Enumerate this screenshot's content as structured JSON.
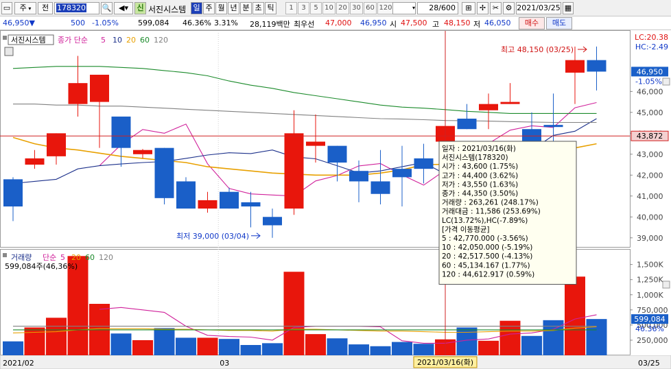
{
  "toolbar": {
    "market_label": "주",
    "prev_label": "전",
    "code": "178320",
    "credit_label": "신",
    "stock_name": "서진시스템",
    "period_tabs": [
      "일",
      "주",
      "월",
      "년",
      "분",
      "초",
      "틱"
    ],
    "active_period": "일",
    "minute_values": [
      "1",
      "3",
      "5",
      "10",
      "20",
      "30",
      "60",
      "120"
    ],
    "count": "28/600",
    "date": "2021/03/25"
  },
  "quote": {
    "price": "46,950",
    "arrow": "▼",
    "change": "500",
    "change_pct": "-1.05%",
    "volume": "599,084",
    "volume_ratio": "46.36%",
    "turnover": "3.31%",
    "amount": "28,119백만",
    "best_bid_label": "최우선",
    "best_ask": "47,000",
    "best_bid": "46,950",
    "open_label": "시",
    "open": "47,500",
    "high_label": "고",
    "high": "48,150",
    "low_label": "저",
    "low": "46,050",
    "buy_label": "매수",
    "sell_label": "매도"
  },
  "price_panel": {
    "title": "서진시스템",
    "ma_label": "종가 단순",
    "ma_periods": [
      "5",
      "10",
      "20",
      "60",
      "120"
    ],
    "lc": "LC:20.38",
    "hc": "HC:-2.49",
    "high_annotation": "최고 48,150 (03/25)",
    "low_annotation": "최저 39,000 (03/04)",
    "last_price_tag": "46,950",
    "last_pct_tag": "-1.05%",
    "crosshair_price_tag": "43,872",
    "y_ticks": [
      "46,000",
      "45,000",
      "44,000",
      "43,000",
      "42,000",
      "41,000",
      "40,000",
      "39,000"
    ]
  },
  "volume_panel": {
    "title": "거래량",
    "ma_label": "단순",
    "ma_periods": [
      "5",
      "20",
      "60",
      "120"
    ],
    "volume_text": "599,084주(46,36%)",
    "last_volume_tag": "599,084",
    "last_pct_tag": "46.36%",
    "y_ticks": [
      "1,500K",
      "1,250K",
      "1,000K",
      "750,000",
      "500,000",
      "250,000"
    ]
  },
  "x_axis": {
    "labels": [
      "2021/02",
      "03"
    ],
    "crosshair_date": "2021/03/16(화)",
    "right_label": "03/25"
  },
  "tooltip": {
    "lines": [
      "일자       : 2021/03/16(화)",
      "서진시스템(178320)",
      " 시가      : 43,600 (1.75%)",
      " 고가      : 44,400 (3.62%)",
      " 저가      : 43,550 (1.63%)",
      " 종가      : 44,350 (3.50%)",
      " 거래량    : 263,261 (248.17%)",
      " 거래대금  : 11,586 (253.69%)",
      " LC(13.72%),HC(-7.89%)",
      "[가격 이동평균]",
      " 5         : 42,770.000 (-3.56%)",
      " 10        : 42,050.000 (-5.19%)",
      " 20        : 42,517.500 (-4.13%)",
      " 60        : 45,134.167 (1.77%)",
      " 120       : 44,612.917 (0.59%)"
    ]
  },
  "colors": {
    "up": "#e8160c",
    "down": "#1a5fc8",
    "ma5": "#d0209a",
    "ma10": "#1a2f8a",
    "ma20": "#e8a000",
    "ma60": "#1a8a2a",
    "ma120": "#808080"
  },
  "chart_data": {
    "type": "candlestick",
    "x": [
      "02/15",
      "02/16",
      "02/17",
      "02/18",
      "02/19",
      "02/22",
      "02/23",
      "02/24",
      "02/25",
      "02/26",
      "03/02",
      "03/03",
      "03/04",
      "03/05",
      "03/08",
      "03/09",
      "03/10",
      "03/11",
      "03/12",
      "03/15",
      "03/16",
      "03/17",
      "03/18",
      "03/19",
      "03/22",
      "03/23",
      "03/24",
      "03/25"
    ],
    "open": [
      41800,
      42500,
      42900,
      45400,
      45500,
      44800,
      43000,
      43300,
      41700,
      40400,
      41200,
      40700,
      40000,
      40400,
      43400,
      43400,
      42200,
      41700,
      42300,
      42800,
      43600,
      44700,
      45100,
      45400,
      44200,
      44400,
      46900,
      47500
    ],
    "high": [
      41900,
      43200,
      44000,
      47700,
      46700,
      44800,
      43250,
      43300,
      41900,
      41200,
      41400,
      41200,
      40400,
      45100,
      44900,
      43400,
      42700,
      43200,
      43400,
      43500,
      44400,
      45400,
      45900,
      46400,
      45000,
      45900,
      48150,
      48150
    ],
    "low": [
      39800,
      42300,
      42500,
      44800,
      43300,
      42400,
      42800,
      40600,
      41000,
      40200,
      40400,
      39500,
      39000,
      40100,
      42600,
      41700,
      40700,
      40600,
      40500,
      41600,
      43550,
      44200,
      44200,
      45400,
      42800,
      43600,
      45400,
      46050
    ],
    "close": [
      40500,
      42800,
      44000,
      46400,
      46800,
      43300,
      43200,
      40900,
      40400,
      40800,
      40400,
      40500,
      39600,
      44000,
      43600,
      42600,
      41700,
      41100,
      41900,
      42300,
      44350,
      44200,
      45400,
      45500,
      43300,
      44300,
      47500,
      46950
    ],
    "volume": [
      230000,
      460000,
      620000,
      1640000,
      850000,
      360000,
      250000,
      450000,
      290000,
      290000,
      270000,
      170000,
      200000,
      1380000,
      350000,
      280000,
      180000,
      150000,
      220000,
      190000,
      263261,
      460000,
      240000,
      570000,
      320000,
      580000,
      1300000,
      599084
    ],
    "series": [
      {
        "name": "5",
        "values": [
          null,
          null,
          null,
          null,
          42450,
          43460,
          44180,
          44000,
          44440,
          42540,
          41360,
          41100,
          41050,
          41000,
          41720,
          41980,
          42440,
          42550,
          42010,
          41520,
          42240,
          42740,
          43510,
          44150,
          44360,
          44280,
          45220,
          45470
        ]
      },
      {
        "name": "10",
        "values": [
          41600,
          41700,
          41800,
          42300,
          42450,
          42530,
          42600,
          42650,
          42800,
          42960,
          43070,
          43030,
          43200,
          42870,
          42780,
          42450,
          42100,
          42200,
          42400,
          42600,
          42050,
          42280,
          42630,
          42900,
          43200,
          43900,
          44100,
          44700
        ]
      },
      {
        "name": "20",
        "values": [
          43800,
          43500,
          43300,
          43200,
          43050,
          42900,
          42800,
          42700,
          42600,
          42400,
          42300,
          42200,
          42100,
          42050,
          42000,
          42000,
          42000,
          42100,
          42250,
          42500,
          42517,
          42600,
          42750,
          42900,
          43000,
          43100,
          43300,
          43500
        ]
      },
      {
        "name": "60",
        "values": [
          47100,
          47150,
          47200,
          47200,
          47200,
          47150,
          47100,
          47000,
          46900,
          46750,
          46500,
          46300,
          46150,
          45950,
          45800,
          45650,
          45500,
          45350,
          45250,
          45200,
          45134,
          45050,
          45000,
          44950,
          44950,
          44950,
          44950,
          44950
        ]
      },
      {
        "name": "120",
        "values": [
          45400,
          45400,
          45350,
          45350,
          45300,
          45300,
          45250,
          45200,
          45150,
          45100,
          45050,
          45000,
          44950,
          44900,
          44850,
          44800,
          44750,
          44700,
          44680,
          44650,
          44612,
          44600,
          44580,
          44560,
          44540,
          44520,
          44520,
          44520
        ]
      }
    ],
    "volume_series": [
      {
        "name": "5",
        "values": [
          null,
          null,
          null,
          null,
          760000,
          790000,
          750000,
          710000,
          480000,
          330000,
          310000,
          300000,
          250000,
          460000,
          480000,
          480000,
          480000,
          470000,
          240000,
          200000,
          200000,
          250000,
          270000,
          350000,
          370000,
          430000,
          600000,
          670000
        ]
      },
      {
        "name": "20",
        "values": [
          370000,
          380000,
          390000,
          420000,
          440000,
          440000,
          440000,
          430000,
          430000,
          420000,
          410000,
          410000,
          400000,
          430000,
          430000,
          420000,
          410000,
          400000,
          400000,
          390000,
          380000,
          380000,
          390000,
          400000,
          400000,
          410000,
          450000,
          470000
        ]
      },
      {
        "name": "60",
        "values": [
          420000,
          420000,
          420000,
          420000,
          420000,
          420000,
          420000,
          420000,
          420000,
          420000,
          420000,
          420000,
          420000,
          420000,
          420000,
          420000,
          420000,
          420000,
          420000,
          420000,
          420000,
          420000,
          420000,
          420000,
          420000,
          420000,
          420000,
          420000
        ]
      },
      {
        "name": "120",
        "values": [
          480000,
          480000,
          480000,
          480000,
          480000,
          480000,
          480000,
          480000,
          480000,
          480000,
          480000,
          480000,
          480000,
          480000,
          480000,
          480000,
          480000,
          480000,
          480000,
          480000,
          480000,
          480000,
          480000,
          480000,
          480000,
          480000,
          480000,
          480000
        ]
      }
    ],
    "price_ylim": [
      38500,
      48800
    ],
    "volume_ylim": [
      0,
      1700000
    ]
  }
}
